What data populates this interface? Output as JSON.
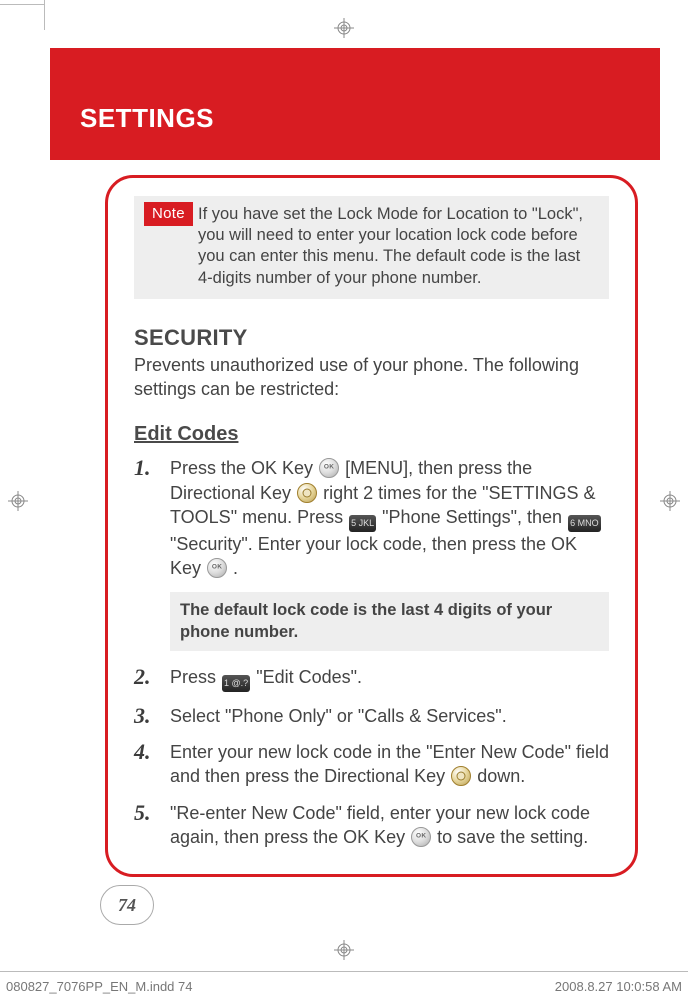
{
  "header": {
    "title": "SETTINGS"
  },
  "note": {
    "label": "Note",
    "text": "If you have set the Lock Mode for Location to \"Lock\", you will need to enter your location lock code before you can enter this menu. The default code is the last 4-digits number of your phone number."
  },
  "sections": {
    "security": {
      "heading": "SECURITY",
      "body": "Prevents unauthorized use of your phone. The following settings can be restricted:"
    },
    "editCodes": {
      "heading": "Edit Codes",
      "steps": [
        {
          "num": "1.",
          "parts": {
            "a": "Press the OK Key ",
            "b": " [MENU], then press the Directional Key ",
            "c": " right 2 times for the \"SETTINGS & TOOLS\" menu. Press ",
            "d": " \"Phone Settings\", then ",
            "e": " \"Security\". Enter your lock code, then press the OK Key ",
            "f": " .",
            "key5": "5 JKL",
            "key6": "6 MNO"
          }
        },
        {
          "num": "2.",
          "parts": {
            "a": "Press ",
            "b": " \"Edit Codes\".",
            "key1": "1 @.?"
          }
        },
        {
          "num": "3.",
          "text": "Select \"Phone Only\" or \"Calls & Services\"."
        },
        {
          "num": "4.",
          "parts": {
            "a": "Enter your new lock code in the \"Enter New Code\" field and then press the Directional Key ",
            "b": " down."
          }
        },
        {
          "num": "5.",
          "parts": {
            "a": "\"Re-enter New Code\" field, enter your new lock code again, then press the OK Key ",
            "b": " to save the setting."
          }
        }
      ],
      "tip": "The default lock code is the last 4 digits of your phone number."
    }
  },
  "pageNumber": "74",
  "footer": {
    "left": "080827_7076PP_EN_M.indd   74",
    "right": "2008.8.27   10:0:58 AM"
  }
}
